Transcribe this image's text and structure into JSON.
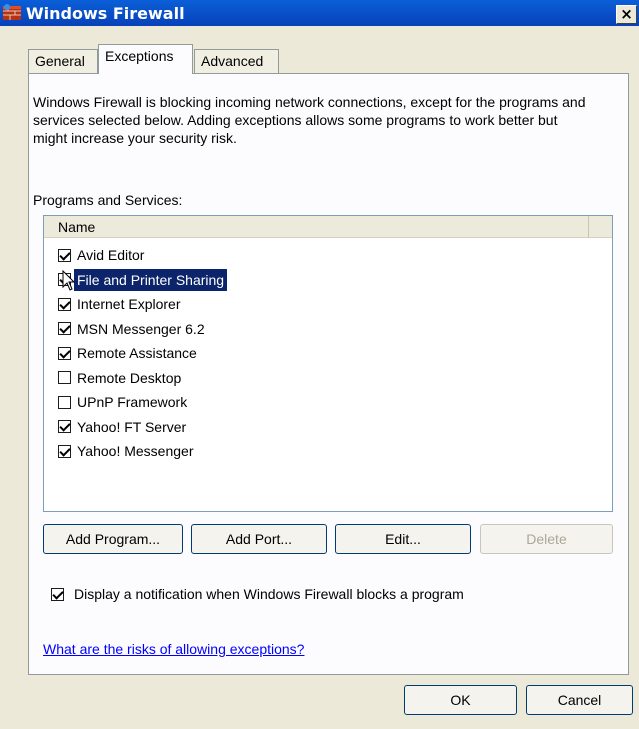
{
  "window": {
    "title": "Windows Firewall",
    "close_glyph": "×",
    "title_icon": "firewall-icon"
  },
  "tabs": [
    {
      "label": "General",
      "active": false
    },
    {
      "label": "Exceptions",
      "active": true
    },
    {
      "label": "Advanced",
      "active": false
    }
  ],
  "intro_text": "Windows Firewall is blocking incoming network connections, except for the programs and services selected below. Adding exceptions allows some programs to work better but might increase your security risk.",
  "programs_label": "Programs and Services:",
  "list": {
    "column_header": "Name",
    "items": [
      {
        "label": "Avid Editor",
        "checked": true,
        "selected": false
      },
      {
        "label": "File and Printer Sharing",
        "checked": true,
        "selected": true
      },
      {
        "label": "Internet Explorer",
        "checked": true,
        "selected": false
      },
      {
        "label": "MSN Messenger 6.2",
        "checked": true,
        "selected": false
      },
      {
        "label": "Remote Assistance",
        "checked": true,
        "selected": false
      },
      {
        "label": "Remote Desktop",
        "checked": false,
        "selected": false
      },
      {
        "label": "UPnP Framework",
        "checked": false,
        "selected": false
      },
      {
        "label": "Yahoo! FT Server",
        "checked": true,
        "selected": false
      },
      {
        "label": "Yahoo! Messenger",
        "checked": true,
        "selected": false
      }
    ]
  },
  "buttons": {
    "add_program": "Add Program...",
    "add_port": "Add Port...",
    "edit": "Edit...",
    "delete": "Delete",
    "ok": "OK",
    "cancel": "Cancel"
  },
  "notification": {
    "label": "Display a notification when Windows Firewall blocks a program",
    "checked": true
  },
  "risk_link": "What are the risks of allowing exceptions?",
  "colors": {
    "titlebar": "#0a5fd8",
    "selection": "#0b246a",
    "link": "#0000ff",
    "dialog_bg": "#ece9d8"
  }
}
